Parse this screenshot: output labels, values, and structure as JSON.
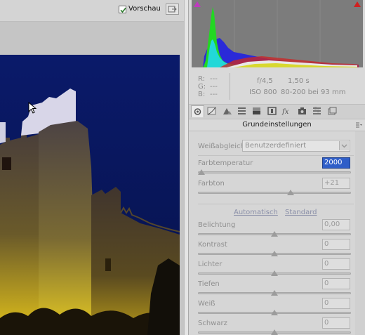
{
  "toolbar": {
    "preview_label": "Vorschau",
    "preview_checked": true
  },
  "histogram": {
    "shadow_clip_color": "#c03ac0",
    "highlight_clip_color": "#d02020"
  },
  "info": {
    "r_label": "R:",
    "r_value": "---",
    "g_label": "G:",
    "g_value": "---",
    "b_label": "B:",
    "b_value": "---",
    "aperture": "f/4,5",
    "shutter": "1,50 s",
    "iso": "ISO 800",
    "lens": "80-200 bei 93 mm"
  },
  "tabs": [
    "basic-adjust-icon",
    "tone-curve-icon",
    "detail-icon",
    "hsl-icon",
    "split-toning-icon",
    "lens-icon",
    "fx-icon",
    "camera-calibration-icon",
    "presets-icon",
    "snapshots-icon"
  ],
  "section": {
    "title": "Grundeinstellungen",
    "menu_icon": "panel-menu-icon"
  },
  "white_balance": {
    "label": "Weißabgleich:",
    "value": "Benutzerdefiniert"
  },
  "sliders": [
    {
      "id": "temperature",
      "label": "Farbtemperatur",
      "value": "2000",
      "level": 0.0
    },
    {
      "id": "tint",
      "label": "Farbton",
      "value": "+21",
      "level": 0.61
    },
    {
      "id": "exposure",
      "label": "Belichtung",
      "value": "0,00",
      "level": 0.5
    },
    {
      "id": "contrast",
      "label": "Kontrast",
      "value": "0",
      "level": 0.5
    },
    {
      "id": "highlights",
      "label": "Lichter",
      "value": "0",
      "level": 0.5
    },
    {
      "id": "shadows",
      "label": "Tiefen",
      "value": "0",
      "level": 0.5
    },
    {
      "id": "whites",
      "label": "Weiß",
      "value": "0",
      "level": 0.5
    },
    {
      "id": "blacks",
      "label": "Schwarz",
      "value": "0",
      "level": 0.5
    }
  ],
  "tone_links": {
    "auto": "Automatisch",
    "default": "Standard"
  }
}
